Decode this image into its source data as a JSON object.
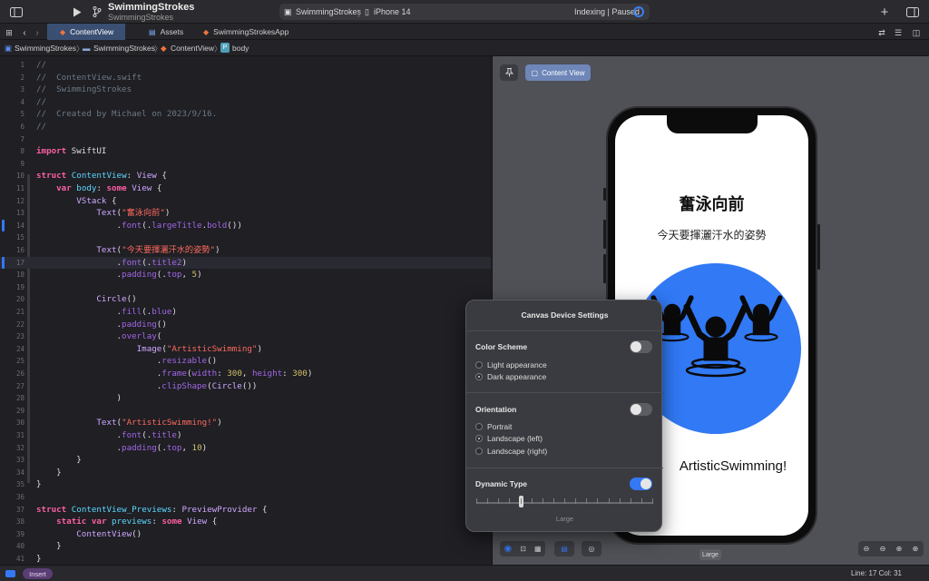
{
  "toolbar": {
    "project_name": "SwimmingStrokes",
    "project_subtitle": "SwimmingStrokes",
    "scheme": "SwimmingStrokes",
    "destination": "iPhone 14",
    "status": "Indexing | Paused"
  },
  "tabs": [
    {
      "label": "ContentView",
      "active": true
    },
    {
      "label": "Assets",
      "active": false
    },
    {
      "label": "SwimmingStrokesApp",
      "active": false
    }
  ],
  "breadcrumb": [
    "SwimmingStrokes",
    "SwimmingStrokes",
    "ContentView",
    "body"
  ],
  "editor": {
    "active_line": 17,
    "lines": [
      {
        "n": "1",
        "parts": [
          [
            "cm",
            "//"
          ]
        ]
      },
      {
        "n": "2",
        "parts": [
          [
            "cm",
            "//  ContentView.swift"
          ]
        ]
      },
      {
        "n": "3",
        "parts": [
          [
            "cm",
            "//  SwimmingStrokes"
          ]
        ]
      },
      {
        "n": "4",
        "parts": [
          [
            "cm",
            "//"
          ]
        ]
      },
      {
        "n": "5",
        "parts": [
          [
            "cm",
            "//  Created by Michael on 2023/9/16."
          ]
        ]
      },
      {
        "n": "6",
        "parts": [
          [
            "cm",
            "//"
          ]
        ]
      },
      {
        "n": "7",
        "parts": []
      },
      {
        "n": "8",
        "parts": [
          [
            "kw",
            "import"
          ],
          [
            "pl",
            " SwiftUI"
          ]
        ]
      },
      {
        "n": "9",
        "parts": []
      },
      {
        "n": "10",
        "parts": [
          [
            "kw",
            "struct"
          ],
          [
            "pl",
            " "
          ],
          [
            "tyd",
            "ContentView"
          ],
          [
            "pl",
            ": "
          ],
          [
            "ty",
            "View"
          ],
          [
            "pl",
            " {"
          ]
        ]
      },
      {
        "n": "11",
        "parts": [
          [
            "pl",
            "    "
          ],
          [
            "kw",
            "var"
          ],
          [
            "pl",
            " "
          ],
          [
            "tyd",
            "body"
          ],
          [
            "pl",
            ": "
          ],
          [
            "kw",
            "some"
          ],
          [
            "pl",
            " "
          ],
          [
            "ty",
            "View"
          ],
          [
            "pl",
            " {"
          ]
        ]
      },
      {
        "n": "12",
        "parts": [
          [
            "pl",
            "        "
          ],
          [
            "ty",
            "VStack"
          ],
          [
            "pl",
            " {"
          ]
        ]
      },
      {
        "n": "13",
        "parts": [
          [
            "pl",
            "            "
          ],
          [
            "ty",
            "Text"
          ],
          [
            "pl",
            "("
          ],
          [
            "st",
            "\"奮泳向前\""
          ],
          [
            "pl",
            ")"
          ]
        ]
      },
      {
        "n": "14",
        "parts": [
          [
            "pl",
            "                ."
          ],
          [
            "md",
            "font"
          ],
          [
            "pl",
            "(."
          ],
          [
            "md",
            "largeTitle"
          ],
          [
            "pl",
            "."
          ],
          [
            "md",
            "bold"
          ],
          [
            "pl",
            "())"
          ]
        ]
      },
      {
        "n": "15",
        "parts": []
      },
      {
        "n": "16",
        "parts": [
          [
            "pl",
            "            "
          ],
          [
            "ty",
            "Text"
          ],
          [
            "pl",
            "("
          ],
          [
            "st",
            "\"今天要揮灑汗水的姿勢\""
          ],
          [
            "pl",
            ")"
          ]
        ]
      },
      {
        "n": "17",
        "parts": [
          [
            "pl",
            "                ."
          ],
          [
            "md",
            "font"
          ],
          [
            "pl",
            "(."
          ],
          [
            "md",
            "title2"
          ],
          [
            "pl",
            ")"
          ]
        ]
      },
      {
        "n": "18",
        "parts": [
          [
            "pl",
            "                ."
          ],
          [
            "md",
            "padding"
          ],
          [
            "pl",
            "(."
          ],
          [
            "md",
            "top"
          ],
          [
            "pl",
            ", "
          ],
          [
            "nm",
            "5"
          ],
          [
            "pl",
            ")"
          ]
        ]
      },
      {
        "n": "19",
        "parts": []
      },
      {
        "n": "20",
        "parts": [
          [
            "pl",
            "            "
          ],
          [
            "ty",
            "Circle"
          ],
          [
            "pl",
            "()"
          ]
        ]
      },
      {
        "n": "21",
        "parts": [
          [
            "pl",
            "                ."
          ],
          [
            "md",
            "fill"
          ],
          [
            "pl",
            "(."
          ],
          [
            "md",
            "blue"
          ],
          [
            "pl",
            ")"
          ]
        ]
      },
      {
        "n": "22",
        "parts": [
          [
            "pl",
            "                ."
          ],
          [
            "md",
            "padding"
          ],
          [
            "pl",
            "()"
          ]
        ]
      },
      {
        "n": "23",
        "parts": [
          [
            "pl",
            "                ."
          ],
          [
            "md",
            "overlay"
          ],
          [
            "pl",
            "("
          ]
        ]
      },
      {
        "n": "24",
        "parts": [
          [
            "pl",
            "                    "
          ],
          [
            "ty",
            "Image"
          ],
          [
            "pl",
            "("
          ],
          [
            "st",
            "\"ArtisticSwimming\""
          ],
          [
            "pl",
            ")"
          ]
        ]
      },
      {
        "n": "25",
        "parts": [
          [
            "pl",
            "                        ."
          ],
          [
            "md",
            "resizable"
          ],
          [
            "pl",
            "()"
          ]
        ]
      },
      {
        "n": "26",
        "parts": [
          [
            "pl",
            "                        ."
          ],
          [
            "md",
            "frame"
          ],
          [
            "pl",
            "("
          ],
          [
            "md",
            "width"
          ],
          [
            "pl",
            ": "
          ],
          [
            "nm",
            "300"
          ],
          [
            "pl",
            ", "
          ],
          [
            "md",
            "height"
          ],
          [
            "pl",
            ": "
          ],
          [
            "nm",
            "300"
          ],
          [
            "pl",
            ")"
          ]
        ]
      },
      {
        "n": "27",
        "parts": [
          [
            "pl",
            "                        ."
          ],
          [
            "md",
            "clipShape"
          ],
          [
            "pl",
            "("
          ],
          [
            "ty",
            "Circle"
          ],
          [
            "pl",
            "())"
          ]
        ]
      },
      {
        "n": "28",
        "parts": [
          [
            "pl",
            "                )"
          ]
        ]
      },
      {
        "n": "29",
        "parts": []
      },
      {
        "n": "30",
        "parts": [
          [
            "pl",
            "            "
          ],
          [
            "ty",
            "Text"
          ],
          [
            "pl",
            "("
          ],
          [
            "st",
            "\"ArtisticSwimming!\""
          ],
          [
            "pl",
            ")"
          ]
        ]
      },
      {
        "n": "31",
        "parts": [
          [
            "pl",
            "                ."
          ],
          [
            "md",
            "font"
          ],
          [
            "pl",
            "(."
          ],
          [
            "md",
            "title"
          ],
          [
            "pl",
            ")"
          ]
        ]
      },
      {
        "n": "32",
        "parts": [
          [
            "pl",
            "                ."
          ],
          [
            "md",
            "padding"
          ],
          [
            "pl",
            "(."
          ],
          [
            "md",
            "top"
          ],
          [
            "pl",
            ", "
          ],
          [
            "nm",
            "10"
          ],
          [
            "pl",
            ")"
          ]
        ]
      },
      {
        "n": "33",
        "parts": [
          [
            "pl",
            "        }"
          ]
        ]
      },
      {
        "n": "34",
        "parts": [
          [
            "pl",
            "    }"
          ]
        ]
      },
      {
        "n": "35",
        "parts": [
          [
            "pl",
            "}"
          ]
        ]
      },
      {
        "n": "36",
        "parts": []
      },
      {
        "n": "37",
        "parts": [
          [
            "kw",
            "struct"
          ],
          [
            "pl",
            " "
          ],
          [
            "tyd",
            "ContentView_Previews"
          ],
          [
            "pl",
            ": "
          ],
          [
            "ty",
            "PreviewProvider"
          ],
          [
            "pl",
            " {"
          ]
        ]
      },
      {
        "n": "38",
        "parts": [
          [
            "pl",
            "    "
          ],
          [
            "kw",
            "static"
          ],
          [
            "pl",
            " "
          ],
          [
            "kw",
            "var"
          ],
          [
            "pl",
            " "
          ],
          [
            "tyd",
            "previews"
          ],
          [
            "pl",
            ": "
          ],
          [
            "kw",
            "some"
          ],
          [
            "pl",
            " "
          ],
          [
            "ty",
            "View"
          ],
          [
            "pl",
            " {"
          ]
        ]
      },
      {
        "n": "39",
        "parts": [
          [
            "pl",
            "        "
          ],
          [
            "ty",
            "ContentView"
          ],
          [
            "pl",
            "()"
          ]
        ]
      },
      {
        "n": "40",
        "parts": [
          [
            "pl",
            "    }"
          ]
        ]
      },
      {
        "n": "41",
        "parts": [
          [
            "pl",
            "}"
          ]
        ]
      }
    ]
  },
  "canvas": {
    "view_button": "Content View",
    "preview_title": "奮泳向前",
    "preview_subtitle": "今天要揮灑汗水的姿勢",
    "preview_caption": "ArtisticSwimming!",
    "size_badge": "Large"
  },
  "device_settings": {
    "title": "Canvas Device Settings",
    "color_scheme": {
      "label": "Color Scheme",
      "enabled": false,
      "options": [
        {
          "label": "Light appearance",
          "selected": false
        },
        {
          "label": "Dark appearance",
          "selected": true
        }
      ]
    },
    "orientation": {
      "label": "Orientation",
      "enabled": false,
      "options": [
        {
          "label": "Portrait",
          "selected": false
        },
        {
          "label": "Landscape (left)",
          "selected": true
        },
        {
          "label": "Landscape (right)",
          "selected": false
        }
      ]
    },
    "dynamic_type": {
      "label": "Dynamic Type",
      "enabled": true,
      "value_label": "Large",
      "position": 0.25
    }
  },
  "statusbar": {
    "mode": "Insert",
    "position": "Line: 17  Col: 31"
  },
  "colors": {
    "accent": "#3478f6",
    "circle": "#3179f5"
  }
}
